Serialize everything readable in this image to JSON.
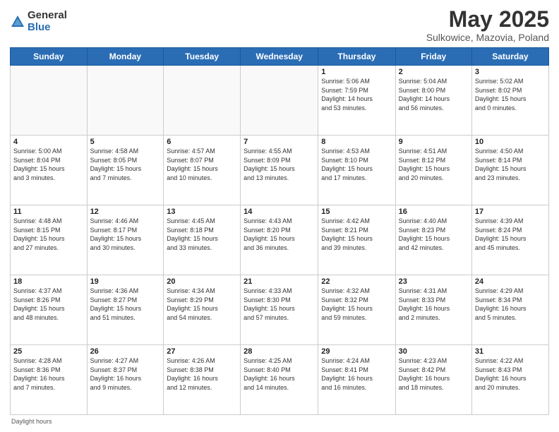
{
  "logo": {
    "general": "General",
    "blue": "Blue"
  },
  "title": "May 2025",
  "subtitle": "Sulkowice, Mazovia, Poland",
  "headers": [
    "Sunday",
    "Monday",
    "Tuesday",
    "Wednesday",
    "Thursday",
    "Friday",
    "Saturday"
  ],
  "weeks": [
    [
      {
        "day": "",
        "info": ""
      },
      {
        "day": "",
        "info": ""
      },
      {
        "day": "",
        "info": ""
      },
      {
        "day": "",
        "info": ""
      },
      {
        "day": "1",
        "info": "Sunrise: 5:06 AM\nSunset: 7:59 PM\nDaylight: 14 hours\nand 53 minutes."
      },
      {
        "day": "2",
        "info": "Sunrise: 5:04 AM\nSunset: 8:00 PM\nDaylight: 14 hours\nand 56 minutes."
      },
      {
        "day": "3",
        "info": "Sunrise: 5:02 AM\nSunset: 8:02 PM\nDaylight: 15 hours\nand 0 minutes."
      }
    ],
    [
      {
        "day": "4",
        "info": "Sunrise: 5:00 AM\nSunset: 8:04 PM\nDaylight: 15 hours\nand 3 minutes."
      },
      {
        "day": "5",
        "info": "Sunrise: 4:58 AM\nSunset: 8:05 PM\nDaylight: 15 hours\nand 7 minutes."
      },
      {
        "day": "6",
        "info": "Sunrise: 4:57 AM\nSunset: 8:07 PM\nDaylight: 15 hours\nand 10 minutes."
      },
      {
        "day": "7",
        "info": "Sunrise: 4:55 AM\nSunset: 8:09 PM\nDaylight: 15 hours\nand 13 minutes."
      },
      {
        "day": "8",
        "info": "Sunrise: 4:53 AM\nSunset: 8:10 PM\nDaylight: 15 hours\nand 17 minutes."
      },
      {
        "day": "9",
        "info": "Sunrise: 4:51 AM\nSunset: 8:12 PM\nDaylight: 15 hours\nand 20 minutes."
      },
      {
        "day": "10",
        "info": "Sunrise: 4:50 AM\nSunset: 8:14 PM\nDaylight: 15 hours\nand 23 minutes."
      }
    ],
    [
      {
        "day": "11",
        "info": "Sunrise: 4:48 AM\nSunset: 8:15 PM\nDaylight: 15 hours\nand 27 minutes."
      },
      {
        "day": "12",
        "info": "Sunrise: 4:46 AM\nSunset: 8:17 PM\nDaylight: 15 hours\nand 30 minutes."
      },
      {
        "day": "13",
        "info": "Sunrise: 4:45 AM\nSunset: 8:18 PM\nDaylight: 15 hours\nand 33 minutes."
      },
      {
        "day": "14",
        "info": "Sunrise: 4:43 AM\nSunset: 8:20 PM\nDaylight: 15 hours\nand 36 minutes."
      },
      {
        "day": "15",
        "info": "Sunrise: 4:42 AM\nSunset: 8:21 PM\nDaylight: 15 hours\nand 39 minutes."
      },
      {
        "day": "16",
        "info": "Sunrise: 4:40 AM\nSunset: 8:23 PM\nDaylight: 15 hours\nand 42 minutes."
      },
      {
        "day": "17",
        "info": "Sunrise: 4:39 AM\nSunset: 8:24 PM\nDaylight: 15 hours\nand 45 minutes."
      }
    ],
    [
      {
        "day": "18",
        "info": "Sunrise: 4:37 AM\nSunset: 8:26 PM\nDaylight: 15 hours\nand 48 minutes."
      },
      {
        "day": "19",
        "info": "Sunrise: 4:36 AM\nSunset: 8:27 PM\nDaylight: 15 hours\nand 51 minutes."
      },
      {
        "day": "20",
        "info": "Sunrise: 4:34 AM\nSunset: 8:29 PM\nDaylight: 15 hours\nand 54 minutes."
      },
      {
        "day": "21",
        "info": "Sunrise: 4:33 AM\nSunset: 8:30 PM\nDaylight: 15 hours\nand 57 minutes."
      },
      {
        "day": "22",
        "info": "Sunrise: 4:32 AM\nSunset: 8:32 PM\nDaylight: 15 hours\nand 59 minutes."
      },
      {
        "day": "23",
        "info": "Sunrise: 4:31 AM\nSunset: 8:33 PM\nDaylight: 16 hours\nand 2 minutes."
      },
      {
        "day": "24",
        "info": "Sunrise: 4:29 AM\nSunset: 8:34 PM\nDaylight: 16 hours\nand 5 minutes."
      }
    ],
    [
      {
        "day": "25",
        "info": "Sunrise: 4:28 AM\nSunset: 8:36 PM\nDaylight: 16 hours\nand 7 minutes."
      },
      {
        "day": "26",
        "info": "Sunrise: 4:27 AM\nSunset: 8:37 PM\nDaylight: 16 hours\nand 9 minutes."
      },
      {
        "day": "27",
        "info": "Sunrise: 4:26 AM\nSunset: 8:38 PM\nDaylight: 16 hours\nand 12 minutes."
      },
      {
        "day": "28",
        "info": "Sunrise: 4:25 AM\nSunset: 8:40 PM\nDaylight: 16 hours\nand 14 minutes."
      },
      {
        "day": "29",
        "info": "Sunrise: 4:24 AM\nSunset: 8:41 PM\nDaylight: 16 hours\nand 16 minutes."
      },
      {
        "day": "30",
        "info": "Sunrise: 4:23 AM\nSunset: 8:42 PM\nDaylight: 16 hours\nand 18 minutes."
      },
      {
        "day": "31",
        "info": "Sunrise: 4:22 AM\nSunset: 8:43 PM\nDaylight: 16 hours\nand 20 minutes."
      }
    ]
  ],
  "footer": "Daylight hours"
}
